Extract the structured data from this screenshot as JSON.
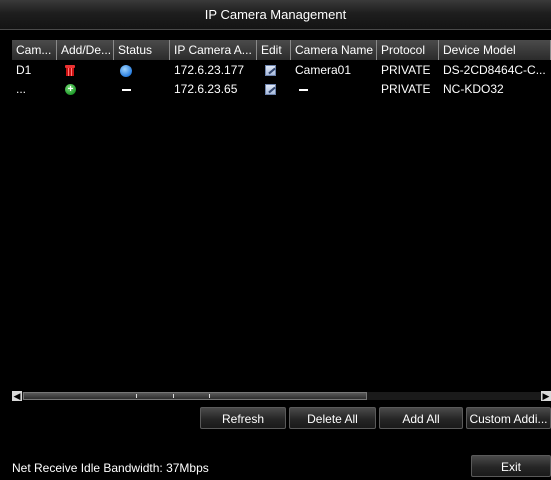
{
  "window": {
    "title": "IP Camera Management"
  },
  "table": {
    "columns": [
      "Cam...",
      "Add/De...",
      "Status",
      "IP Camera A...",
      "Edit",
      "Camera Name",
      "Protocol",
      "Device Model"
    ],
    "rows": [
      {
        "cam": "D1",
        "action_icon": "delete-icon",
        "status": "online-icon",
        "ip": "172.6.23.177",
        "edit_icon": "edit-icon",
        "name": "Camera01",
        "protocol": "PRIVATE",
        "model": "DS-2CD8464C-C..."
      },
      {
        "cam": "...",
        "action_icon": "add-icon",
        "status": "—",
        "ip": "172.6.23.65",
        "edit_icon": "edit-icon",
        "name": "—",
        "protocol": "PRIVATE",
        "model": "NC-KDO32"
      }
    ]
  },
  "buttons": {
    "refresh": "Refresh",
    "delete_all": "Delete All",
    "add_all": "Add All",
    "custom_add": "Custom Addi...",
    "exit": "Exit"
  },
  "status": {
    "bandwidth": "Net Receive Idle Bandwidth: 37Mbps"
  }
}
